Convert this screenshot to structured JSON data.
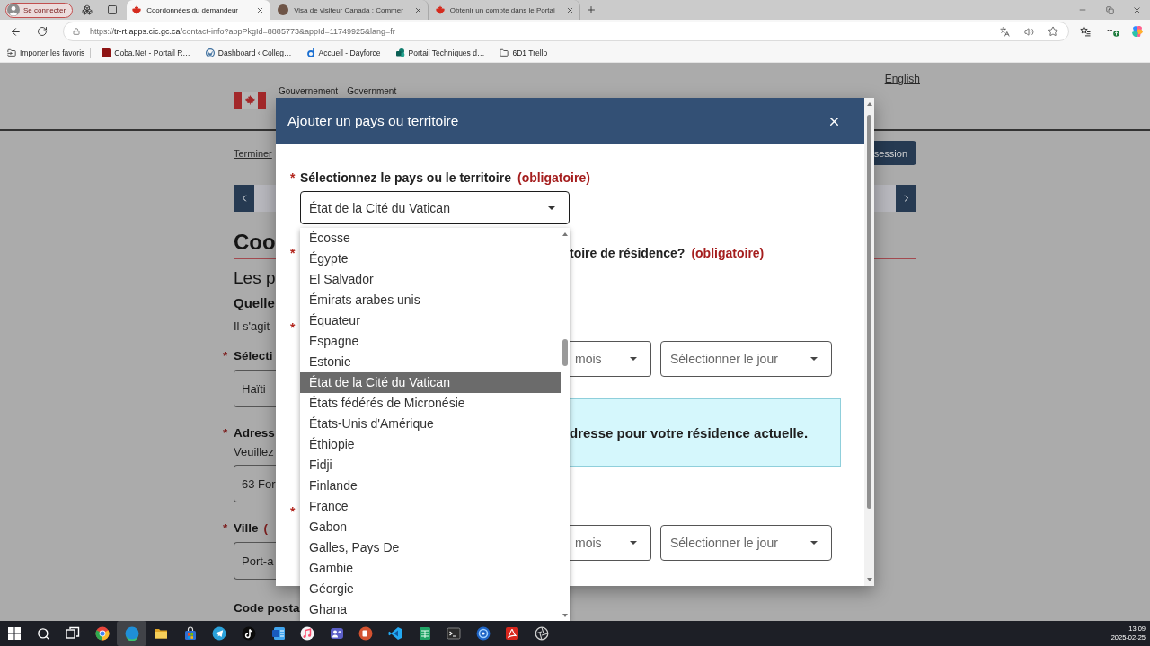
{
  "browser": {
    "profile": {
      "label": "Se connecter"
    },
    "tabs": [
      {
        "kind": "maple",
        "title": "Coordonnées du demandeur",
        "selected": true
      },
      {
        "kind": "avatar",
        "title": "Visa de visiteur Canada : Commer",
        "selected": false
      },
      {
        "kind": "maple",
        "title": "Obtenir un compte dans le Portai",
        "selected": false
      }
    ],
    "address": {
      "scheme": "https://",
      "host": "tr-rt.apps.cic.gc.ca",
      "path": "/contact-info?appPkgId=8885773&appId=11749925&lang=fr"
    },
    "bookmarks": [
      {
        "kind": "import",
        "label": "Importer les favoris"
      },
      {
        "kind": "tile",
        "label": "Coba.Net - Portail R…"
      },
      {
        "kind": "wp",
        "label": "Dashboard ‹ Colleg…"
      },
      {
        "kind": "arc",
        "label": "Accueil - Dayforce"
      },
      {
        "kind": "dots",
        "label": "Portail Techniques d…"
      },
      {
        "kind": "folder",
        "label": "6D1 Trello"
      }
    ]
  },
  "page": {
    "language_link": "English",
    "government": [
      "Gouvernement",
      "Government"
    ],
    "exit_link": "Terminer",
    "session_button": "session",
    "heading": "Coo",
    "subheading": "Les p",
    "question": "Quelle",
    "hint": "Il s'agit",
    "fields": [
      {
        "marker": "*",
        "label": "Sélecti",
        "value": "Haïti"
      },
      {
        "marker": "*",
        "label": "Adress",
        "help": "Veuillez",
        "value": "63 For"
      },
      {
        "marker": "*",
        "label": "Ville",
        "required": "(",
        "value": "Port-a"
      }
    ],
    "postal_label": "Code posta"
  },
  "modal": {
    "title": "Ajouter un pays ou territoire",
    "country": {
      "marker": "*",
      "label": "Sélectionnez le pays ou le territoire",
      "required": "(obligatoire)",
      "value": "État de la Cité du Vatican",
      "expanded": true,
      "options": [
        {
          "label": "Écosse",
          "selected": false
        },
        {
          "label": "Égypte",
          "selected": false
        },
        {
          "label": "El Salvador",
          "selected": false
        },
        {
          "label": "Émirats arabes unis",
          "selected": false
        },
        {
          "label": "Équateur",
          "selected": false
        },
        {
          "label": "Espagne",
          "selected": false
        },
        {
          "label": "Estonie",
          "selected": false
        },
        {
          "label": "État de la Cité du Vatican",
          "selected": true
        },
        {
          "label": "États fédérés de Micronésie",
          "selected": false
        },
        {
          "label": "États-Unis d'Amérique",
          "selected": false
        },
        {
          "label": "Éthiopie",
          "selected": false
        },
        {
          "label": "Fidji",
          "selected": false
        },
        {
          "label": "Finlande",
          "selected": false
        },
        {
          "label": "France",
          "selected": false
        },
        {
          "label": "Gabon",
          "selected": false
        },
        {
          "label": "Galles, Pays De",
          "selected": false
        },
        {
          "label": "Gambie",
          "selected": false
        },
        {
          "label": "Géorgie",
          "selected": false
        },
        {
          "label": "Ghana",
          "selected": false
        }
      ]
    },
    "rows": [
      {
        "kind": "question",
        "marker": "*",
        "label": "toire de résidence?",
        "required": "(obligatoire)"
      },
      {
        "kind": "dates",
        "marker": "*",
        "month": {
          "placeholder": "mois"
        },
        "day": {
          "placeholder": "Sélectionner le jour"
        }
      },
      {
        "kind": "notice",
        "text": "dresse pour votre résidence actuelle."
      },
      {
        "kind": "dates",
        "marker": "*",
        "month": {
          "placeholder": "mois"
        },
        "day": {
          "placeholder": "Sélectionner le jour"
        }
      }
    ]
  },
  "taskbar": {
    "items": [
      {
        "kind": "start",
        "selected": false
      },
      {
        "kind": "search",
        "selected": false
      },
      {
        "kind": "task-view",
        "selected": false
      },
      {
        "kind": "ring",
        "selected": false
      },
      {
        "kind": "swirl",
        "selected": true
      },
      {
        "kind": "folder",
        "selected": false
      },
      {
        "kind": "bag",
        "selected": false
      },
      {
        "kind": "plane",
        "selected": false
      },
      {
        "kind": "note",
        "selected": false
      },
      {
        "kind": "doc",
        "selected": false
      },
      {
        "kind": "music",
        "selected": false
      },
      {
        "kind": "people",
        "selected": false
      },
      {
        "kind": "slides",
        "selected": false
      },
      {
        "kind": "code",
        "selected": false
      },
      {
        "kind": "sheet",
        "selected": false
      },
      {
        "kind": "terminal",
        "selected": false
      },
      {
        "kind": "disc",
        "selected": false
      },
      {
        "kind": "pdf",
        "selected": false
      },
      {
        "kind": "aperture",
        "selected": false
      }
    ],
    "time": "13:09",
    "date": "2025-02-25"
  }
}
